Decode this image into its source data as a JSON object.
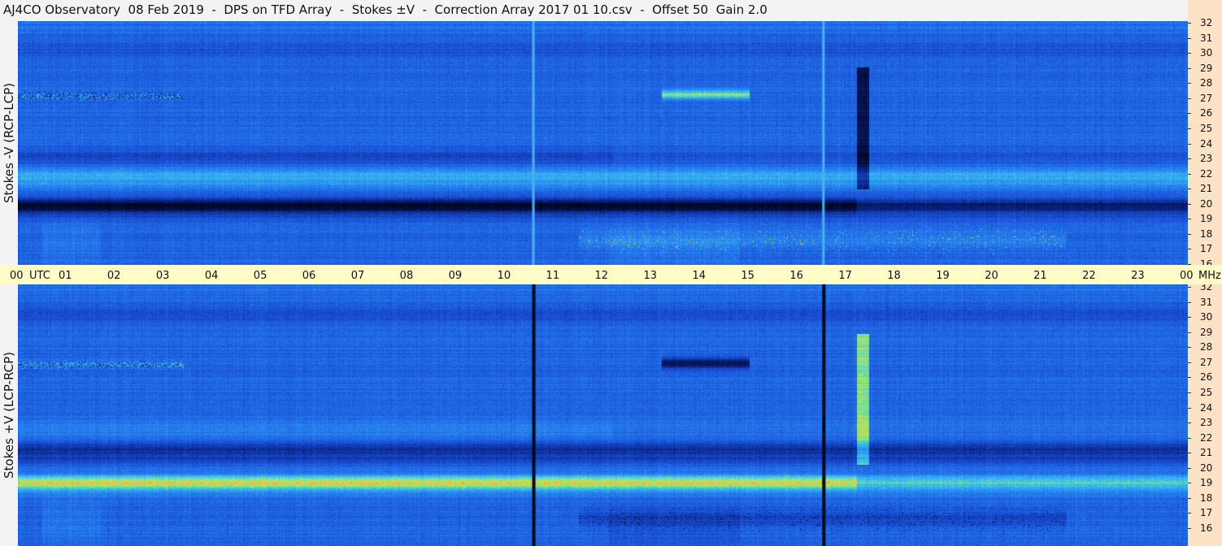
{
  "title": "AJ4CO Observatory  08 Feb 2019  -  DPS on TFD Array  -  Stokes ±V  -  Correction Array 2017 01 10.csv  -  Offset 50  Gain 2.0",
  "chart_data": [
    {
      "type": "heatmap",
      "panel": "top",
      "ylabel": "Stokes -V (RCP-LCP)",
      "xlabel": "UTC",
      "ylim": [
        16,
        32
      ],
      "yunit": "MHz",
      "colormap": [
        "#000820",
        "#0a1e7a",
        "#1d5fe0",
        "#2a8cf0",
        "#3fd3f0",
        "#c8f060",
        "#ffb030"
      ],
      "features": [
        {
          "freq": 20,
          "level": "strong negative",
          "x_range": [
            "00",
            "17"
          ]
        },
        {
          "freq": 22,
          "level": "positive",
          "x_range": [
            "00",
            "24"
          ]
        },
        {
          "freq": 27,
          "level": "mixed bursts",
          "x_range": [
            "00",
            "03"
          ]
        },
        {
          "freq": 27,
          "level": "positive burst",
          "x_range": [
            "13.3",
            "14.7"
          ]
        },
        {
          "freq": 17.5,
          "level": "positive streaks",
          "x_range": [
            "12",
            "21"
          ]
        },
        {
          "time": "10.6",
          "type": "vertical line"
        },
        {
          "time": "16.5",
          "type": "vertical line"
        },
        {
          "time": "17.3",
          "type": "vertical dark burst",
          "freq_range": [
            21,
            29
          ]
        }
      ]
    },
    {
      "type": "heatmap",
      "panel": "bottom",
      "ylabel": "Stokes +V (LCP-RCP)",
      "xlabel": "UTC",
      "ylim": [
        16,
        32
      ],
      "yunit": "MHz",
      "colormap": [
        "#000820",
        "#0a1e7a",
        "#1d5fe0",
        "#2a8cf0",
        "#3fd3f0",
        "#c8f060",
        "#ffb030"
      ],
      "features": [
        {
          "freq": 20,
          "level": "strong positive",
          "x_range": [
            "00",
            "24"
          ]
        },
        {
          "freq": 21.5,
          "level": "negative",
          "x_range": [
            "00",
            "24"
          ]
        },
        {
          "freq": 27,
          "level": "positive bursts",
          "x_range": [
            "00",
            "03.5"
          ]
        },
        {
          "freq": 27,
          "level": "negative burst",
          "x_range": [
            "13",
            "14.8"
          ]
        },
        {
          "time": "10.6",
          "type": "dark vertical line"
        },
        {
          "time": "16.5",
          "type": "dark vertical line"
        },
        {
          "time": "17.3",
          "type": "vertical bright burst",
          "freq_range": [
            20,
            28
          ]
        }
      ]
    }
  ],
  "time_axis": {
    "labels": [
      "00",
      "UTC",
      "01",
      "02",
      "03",
      "04",
      "05",
      "06",
      "07",
      "08",
      "09",
      "10",
      "11",
      "12",
      "13",
      "14",
      "15",
      "16",
      "17",
      "18",
      "19",
      "20",
      "21",
      "22",
      "23",
      "00",
      "MHz"
    ]
  },
  "freq_axis": {
    "labels": [
      "32",
      "31",
      "30",
      "29",
      "28",
      "27",
      "26",
      "25",
      "24",
      "23",
      "22",
      "21",
      "20",
      "19",
      "18",
      "17",
      "16"
    ]
  }
}
